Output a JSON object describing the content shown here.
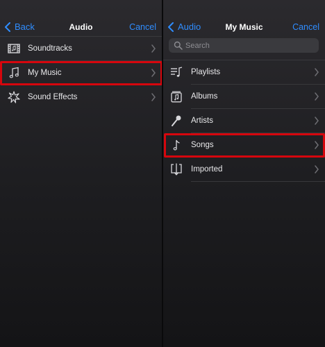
{
  "left": {
    "nav": {
      "back_label": "Back",
      "title": "Audio",
      "cancel_label": "Cancel"
    },
    "items": [
      {
        "label": "Soundtracks",
        "icon": "film-strip-icon"
      },
      {
        "label": "My Music",
        "icon": "music-note-icon",
        "highlighted": true
      },
      {
        "label": "Sound Effects",
        "icon": "burst-icon"
      }
    ]
  },
  "right": {
    "nav": {
      "back_label": "Audio",
      "title": "My Music",
      "cancel_label": "Cancel"
    },
    "search": {
      "placeholder": "Search",
      "value": ""
    },
    "items": [
      {
        "label": "Playlists",
        "icon": "playlist-icon"
      },
      {
        "label": "Albums",
        "icon": "album-icon"
      },
      {
        "label": "Artists",
        "icon": "microphone-icon"
      },
      {
        "label": "Songs",
        "icon": "music-note-icon",
        "highlighted": true
      },
      {
        "label": "Imported",
        "icon": "import-icon"
      }
    ]
  },
  "colors": {
    "accent": "#2f8dff",
    "highlight": "#d6060d",
    "background": "#1d1d20"
  }
}
